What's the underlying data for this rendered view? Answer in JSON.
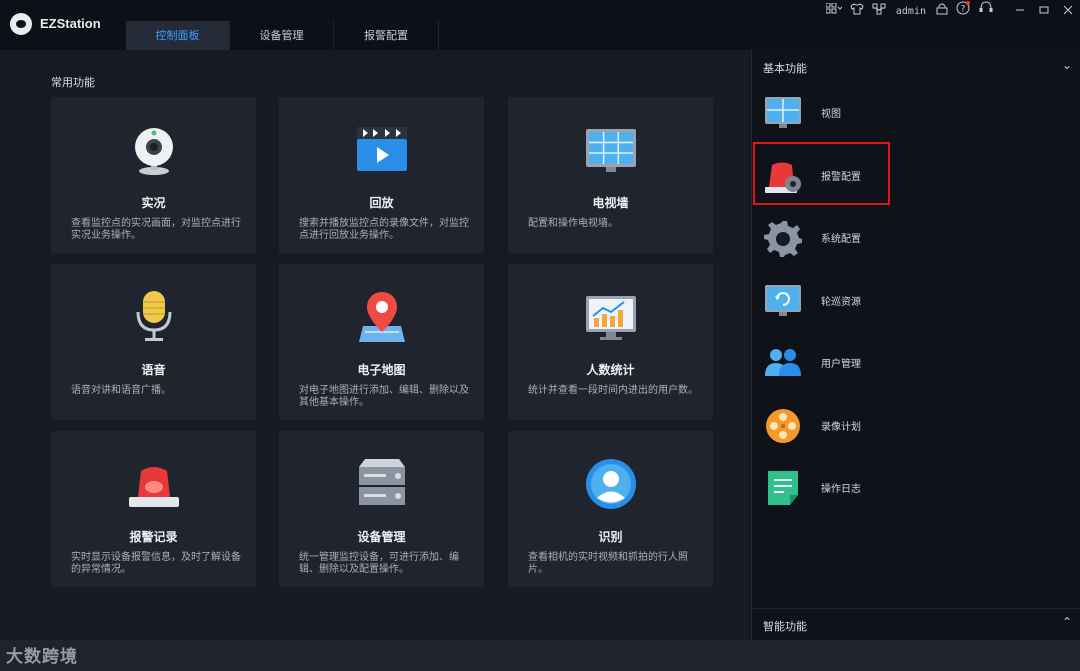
{
  "app": {
    "title": "EZStation"
  },
  "tabs": [
    {
      "label": "控制面板",
      "active": true
    },
    {
      "label": "设备管理",
      "active": false
    },
    {
      "label": "报警配置",
      "active": false
    }
  ],
  "topbar": {
    "user": "admin",
    "icons": [
      "layout-grid-icon",
      "shirt-icon",
      "network-icon",
      "lock-icon",
      "help-icon",
      "support-icon"
    ]
  },
  "main": {
    "section_title": "常用功能",
    "cards": [
      {
        "title": "实况",
        "desc": "查看监控点的实况画面，对监控点进行实况业务操作。",
        "icon": "webcam-icon"
      },
      {
        "title": "回放",
        "desc": "搜索并播放监控点的录像文件，对监控点进行回放业务操作。",
        "icon": "playback-icon"
      },
      {
        "title": "电视墙",
        "desc": "配置和操作电视墙。",
        "icon": "video-wall-icon"
      },
      {
        "title": "语音",
        "desc": "语音对讲和语音广播。",
        "icon": "microphone-icon"
      },
      {
        "title": "电子地图",
        "desc": "对电子地图进行添加、编辑、删除以及其他基本操作。",
        "icon": "map-pin-icon"
      },
      {
        "title": "人数统计",
        "desc": "统计并查看一段时间内进出的用户数。",
        "icon": "people-count-icon"
      },
      {
        "title": "报警记录",
        "desc": "实时显示设备报警信息，及时了解设备的异常情况。",
        "icon": "alarm-light-icon"
      },
      {
        "title": "设备管理",
        "desc": "统一管理监控设备，可进行添加、编辑、删除以及配置操作。",
        "icon": "server-icon"
      },
      {
        "title": "识别",
        "desc": "查看相机的实时视频和抓拍的行人照片。",
        "icon": "face-recognition-icon"
      }
    ]
  },
  "side": {
    "basic_title": "基本功能",
    "items": [
      {
        "label": "视图",
        "icon": "view-icon"
      },
      {
        "label": "报警配置",
        "icon": "alarm-config-icon",
        "highlighted": true
      },
      {
        "label": "系统配置",
        "icon": "system-gear-icon"
      },
      {
        "label": "轮巡资源",
        "icon": "patrol-monitor-icon"
      },
      {
        "label": "用户管理",
        "icon": "users-icon"
      },
      {
        "label": "录像计划",
        "icon": "film-reel-icon"
      },
      {
        "label": "操作日志",
        "icon": "log-note-icon"
      }
    ],
    "smart_title": "智能功能"
  },
  "watermark": "大数跨境"
}
